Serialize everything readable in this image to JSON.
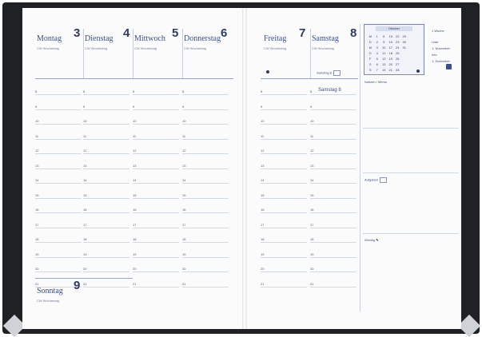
{
  "days": [
    {
      "name": "Montag",
      "num": "3",
      "sub": "CW Wochentag"
    },
    {
      "name": "Dienstag",
      "num": "4",
      "sub": "CW Wochentag"
    },
    {
      "name": "Mittwoch",
      "num": "5",
      "sub": "CW Wochentag"
    },
    {
      "name": "Donnerstag",
      "num": "6",
      "sub": "CW Wochentag"
    },
    {
      "name": "Freitag",
      "num": "7",
      "sub": "CW Wochentag"
    },
    {
      "name": "Samstag",
      "num": "8",
      "sub": "CW Wochentag"
    },
    {
      "name": "Sonntag",
      "num": "9",
      "sub": "CW Wochentag"
    }
  ],
  "hours": [
    "8",
    "9",
    "10",
    "11",
    "12",
    "13",
    "14",
    "15",
    "16",
    "17",
    "18",
    "19",
    "20",
    "21"
  ],
  "samstag_note": "Samstag 8",
  "mini_calendar": {
    "title": "Oktober",
    "cells": [
      "M",
      "1",
      "8",
      "15",
      "22",
      "29",
      "",
      "",
      "D",
      "2",
      "9",
      "16",
      "23",
      "30",
      "",
      "",
      "M",
      "3",
      "10",
      "17",
      "24",
      "31",
      "",
      "",
      "D",
      "4",
      "11",
      "18",
      "25",
      "",
      "",
      "",
      "F",
      "5",
      "12",
      "19",
      "26",
      "",
      "",
      "",
      "S",
      "6",
      "13",
      "20",
      "27",
      "",
      "",
      "",
      "S",
      "7",
      "14",
      "21",
      "28",
      "",
      "",
      ""
    ]
  },
  "right_top_notes": [
    "1 Woche",
    "Liste",
    "1. November",
    "Info",
    "1. Dezember"
  ],
  "right_labels": {
    "notizen": "Notizen / Memo",
    "aufgaben": "Aufgaben",
    "wichtig": "Wichtig"
  },
  "colors": {
    "accent": "#3b4f86",
    "cover": "#1f2124"
  }
}
